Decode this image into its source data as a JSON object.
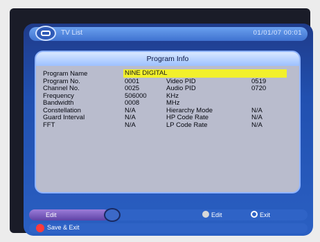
{
  "header": {
    "title": "TV List",
    "datetime": "01/01/07  00:01"
  },
  "panel": {
    "title": "Program Info",
    "rows": [
      {
        "label": "Program Name",
        "value": "NINE DIGITAL",
        "label2": "",
        "value2": ""
      },
      {
        "label": "Program No.",
        "value": "0001",
        "label2": "Video PID",
        "value2": "0519"
      },
      {
        "label": "Channel No.",
        "value": "0025",
        "label2": "Audio PID",
        "value2": "0720"
      },
      {
        "label": "Frequency",
        "value": "506000",
        "label2": "KHz",
        "value2": ""
      },
      {
        "label": "Bandwidth",
        "value": "0008",
        "label2": "MHz",
        "value2": ""
      },
      {
        "label": "Constellation",
        "value": "N/A",
        "label2": "Hierarchy Mode",
        "value2": "N/A"
      },
      {
        "label": "Guard Interval",
        "value": "N/A",
        "label2": "HP Code Rate",
        "value2": "N/A"
      },
      {
        "label": "FFT",
        "value": "N/A",
        "label2": "LP Code Rate",
        "value2": "N/A"
      }
    ]
  },
  "footer": {
    "edit_tab": "Edit",
    "ok_edit_hint": "Edit",
    "exit_hint": "Exit",
    "save_exit": "Save & Exit"
  },
  "colors": {
    "screen_blue": "#2150b0",
    "panel_grey": "#b9bccd",
    "name_highlight": "#f2f02b",
    "save_dot_red": "#ff3b3b"
  },
  "icons": [
    "tv-icon",
    "ok-button-icon",
    "exit-icon",
    "red-button-icon"
  ]
}
